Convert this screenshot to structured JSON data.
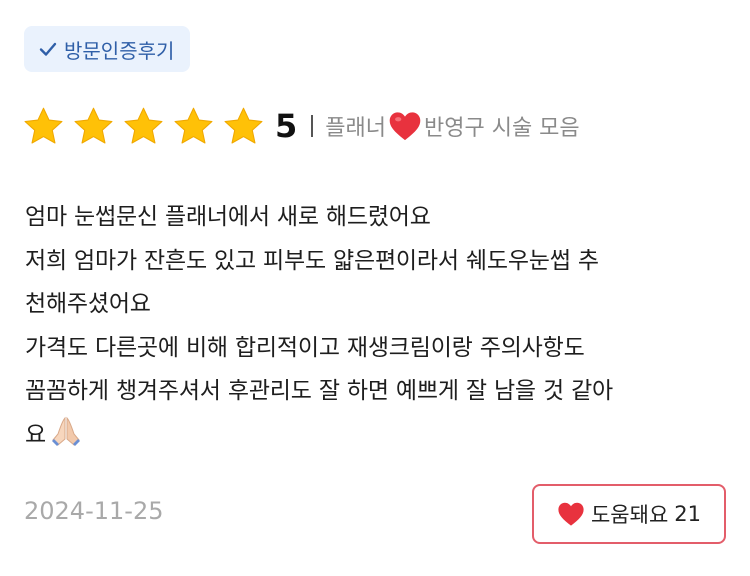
{
  "badge": {
    "label": "방문인증후기",
    "icon": "check-icon",
    "color": "#2f5fa8",
    "background": "#eaf2fd"
  },
  "rating": {
    "stars": 5,
    "max_stars": 5,
    "score": "5",
    "star_color": "#ffc107"
  },
  "shop": {
    "prefix": "플래너",
    "icon": "heart-icon",
    "suffix": "반영구 시술 모음"
  },
  "review": {
    "lines": [
      "엄마 눈썹문신 플래너에서 새로 해드렸어요",
      "저희 엄마가 잔흔도 있고 피부도 얇은편이라서 쉐도우눈썹 추",
      "천해주셨어요",
      "가격도 다른곳에 비해 합리적이고 재생크림이랑 주의사항도",
      "꼼꼼하게 챙겨주셔서 후관리도 잘 하면 예쁘게 잘 남을 것 같아",
      "요"
    ],
    "emoji": "praying-hands-icon"
  },
  "date": "2024-11-25",
  "helpful": {
    "label": "도움돼요",
    "count": "21",
    "icon": "heart-icon",
    "border_color": "#e35d6a",
    "heart_color": "#e8323e"
  }
}
